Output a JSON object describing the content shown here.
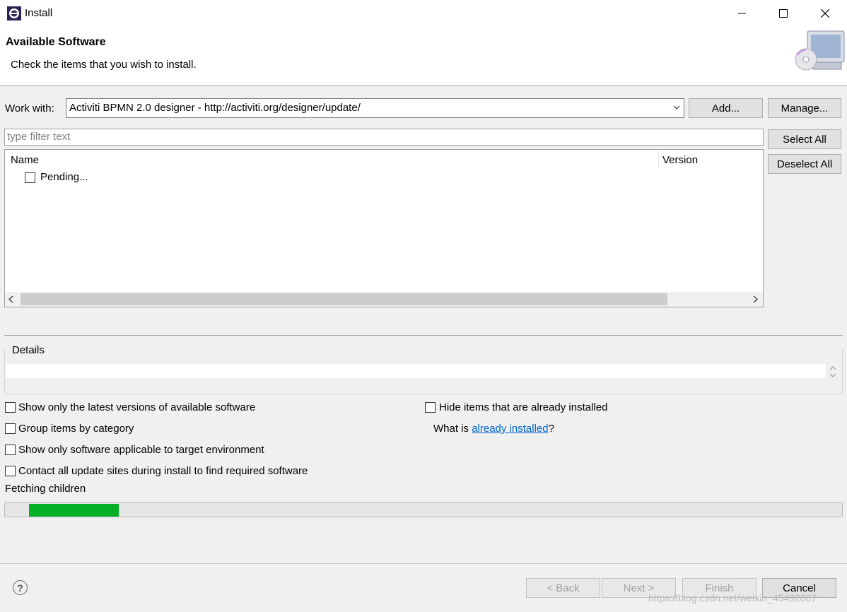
{
  "window": {
    "title": "Install",
    "icon": "eclipse-gear-icon"
  },
  "banner": {
    "title": "Available Software",
    "subtitle": "Check the items that you wish to install.",
    "image": "computer-cd-icon"
  },
  "work_with": {
    "label": "Work with:",
    "value": "Activiti BPMN 2.0 designer - http://activiti.org/designer/update/",
    "add_label": "Add...",
    "manage_label": "Manage..."
  },
  "filter": {
    "placeholder": "type filter text",
    "select_all_label": "Select All",
    "deselect_all_label": "Deselect All"
  },
  "table": {
    "columns": [
      "Name",
      "Version"
    ],
    "rows": [
      {
        "name": "Pending...",
        "checked": false
      }
    ]
  },
  "details": {
    "label": "Details",
    "text": ""
  },
  "options": {
    "latest_versions": "Show only the latest versions of available software",
    "group_by_category": "Group items by category",
    "applicable_only": "Show only software applicable to target environment",
    "contact_sites": "Contact all update sites during install to find required software",
    "hide_installed": "Hide items that are already installed",
    "what_is_prefix": "What is ",
    "what_is_link": "already installed",
    "what_is_suffix": "?"
  },
  "status": {
    "text": "Fetching children",
    "progress_fraction": 0.11
  },
  "footer": {
    "back_label": "< Back",
    "next_label": "Next >",
    "finish_label": "Finish",
    "cancel_label": "Cancel",
    "help_icon": "help-icon",
    "help_glyph": "?"
  },
  "watermark": "https://blog.csdn.net/weixin_45492007",
  "colors": {
    "progress": "#06b025",
    "link": "#0066cc"
  }
}
